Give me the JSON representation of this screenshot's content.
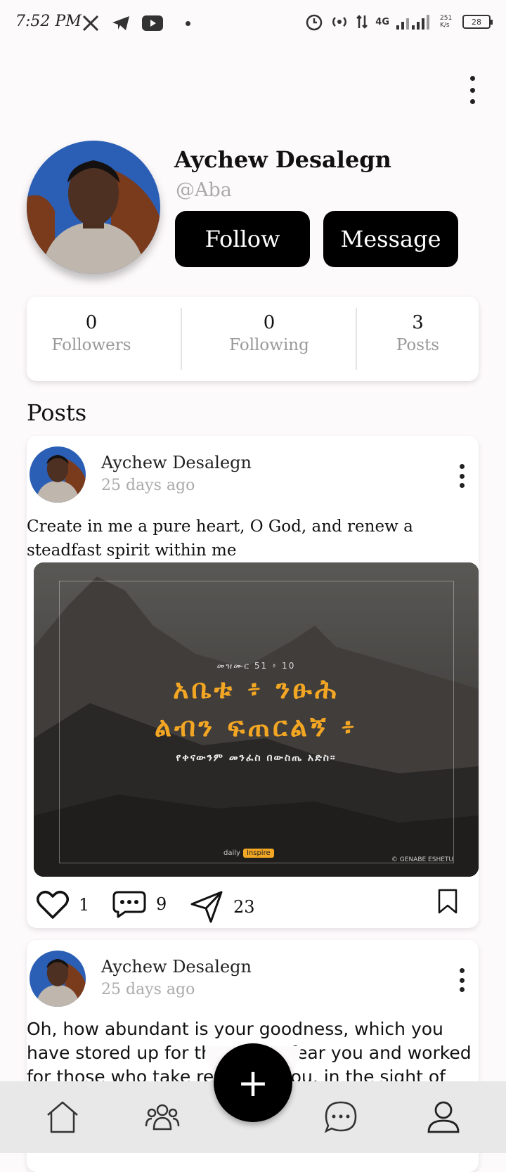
{
  "status_bar": {
    "time": "7:52 PM",
    "network": "4G",
    "speed": "251 K/s",
    "battery": "28"
  },
  "profile": {
    "name": "Aychew Desalegn",
    "handle": "@Aba",
    "follow_label": "Follow",
    "message_label": "Message"
  },
  "stats": {
    "followers_count": "0",
    "followers_label": "Followers",
    "following_count": "0",
    "following_label": "Following",
    "posts_count": "3",
    "posts_label": "Posts"
  },
  "posts_section_title": "Posts",
  "posts": [
    {
      "author": "Aychew Desalegn",
      "time": "25 days ago",
      "text": "Create in me a pure heart, O God, and renew a steadfast spirit within me",
      "image": {
        "reference": "መዝሙር 51 ፥ 10",
        "title_line1": "አቤቱ ፥ ንፁሕ",
        "title_line2": "ልብን ፍጠርልኝ ፥",
        "subtitle": "የቀናውንም መንፈስ በውስጤ አድስ።",
        "brand_prefix": "daily",
        "brand_tag": "Inspire",
        "credit": "© GENABE ESHETU"
      },
      "likes": "1",
      "comments": "9",
      "shares": "23"
    },
    {
      "author": "Aychew Desalegn",
      "time": "25 days ago",
      "text": "Oh, how abundant is your goodness, which you have stored up for those who fear you and worked for those who take refuge in you, in the sight of"
    }
  ],
  "colors": {
    "primary_button": "#000000",
    "muted_text": "#aaaaaa",
    "nav_background": "#e8e8e8",
    "accent_image_text": "#f3a623"
  },
  "nav": {
    "items": [
      "home-icon",
      "friends-icon",
      "add-icon",
      "chat-icon",
      "profile-icon"
    ],
    "fab_symbol": "+"
  }
}
